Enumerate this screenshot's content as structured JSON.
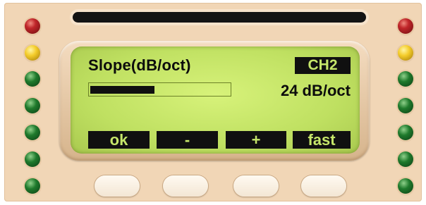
{
  "display": {
    "parameter_title": "Slope(dB/oct)",
    "channel_badge": "CH2",
    "value_readout": "24 dB/oct",
    "level_fraction": 0.46
  },
  "softkeys": [
    {
      "label": "ok"
    },
    {
      "label": "-"
    },
    {
      "label": "+"
    },
    {
      "label": "fast"
    }
  ],
  "leds": {
    "left": [
      "red",
      "yellow",
      "green",
      "green",
      "green",
      "green",
      "green"
    ],
    "right": [
      "red",
      "yellow",
      "green",
      "green",
      "green",
      "green",
      "green"
    ]
  },
  "colors": {
    "lcd_background": "#c6e56c",
    "lcd_ink": "#101010",
    "panel": "#f1d6b6",
    "led_red": "#c0262a",
    "led_yellow": "#f4cc2a",
    "led_green": "#1f7a2c"
  }
}
